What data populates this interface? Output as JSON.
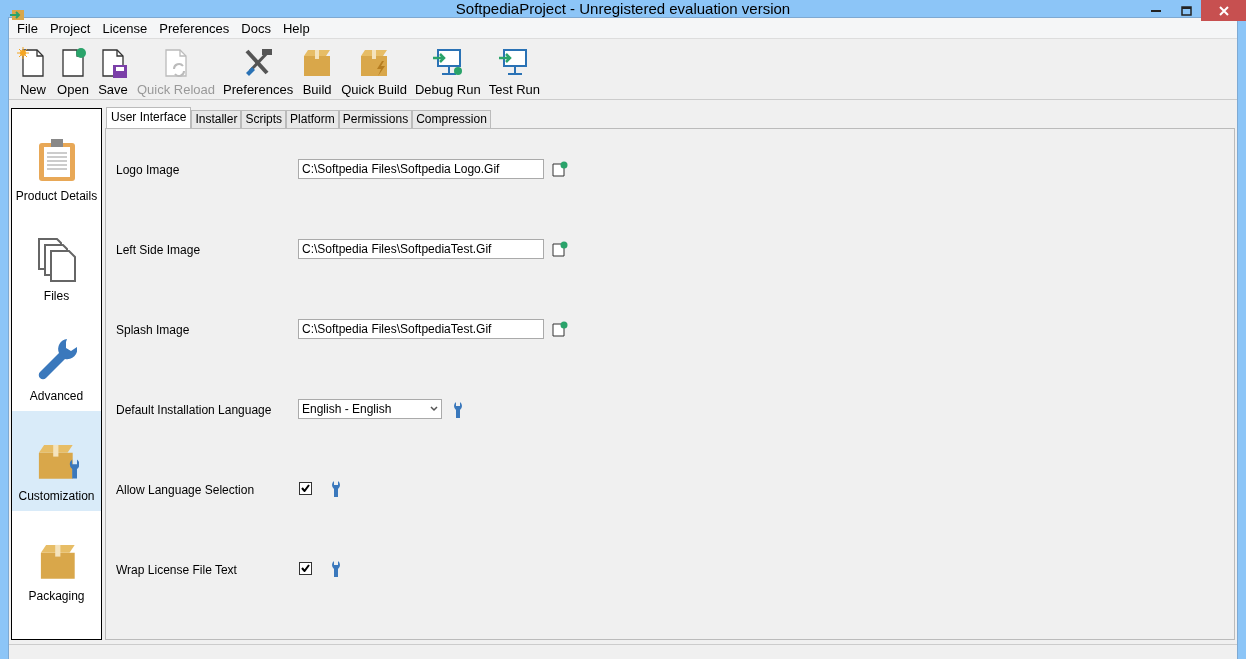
{
  "window": {
    "title": "SoftpediaProject - Unregistered evaluation version"
  },
  "menu": [
    "File",
    "Project",
    "License",
    "Preferences",
    "Docs",
    "Help"
  ],
  "toolbar": [
    {
      "label": "New",
      "kind": "new",
      "disabled": false
    },
    {
      "label": "Open",
      "kind": "open",
      "disabled": false
    },
    {
      "label": "Save",
      "kind": "save",
      "disabled": false
    },
    {
      "label": "Quick Reload",
      "kind": "reload",
      "disabled": true
    },
    {
      "label": "Preferences",
      "kind": "tools",
      "disabled": false
    },
    {
      "label": "Build",
      "kind": "box",
      "disabled": false
    },
    {
      "label": "Quick Build",
      "kind": "quickbox",
      "disabled": false
    },
    {
      "label": "Debug Run",
      "kind": "debug",
      "disabled": false
    },
    {
      "label": "Test Run",
      "kind": "run",
      "disabled": false
    }
  ],
  "sidebar": {
    "items": [
      {
        "label": "Product Details",
        "kind": "clipboard",
        "selected": false
      },
      {
        "label": "Files",
        "kind": "files",
        "selected": false
      },
      {
        "label": "Advanced",
        "kind": "wrench",
        "selected": false
      },
      {
        "label": "Customization",
        "kind": "boxwrench",
        "selected": true
      },
      {
        "label": "Packaging",
        "kind": "box",
        "selected": false
      }
    ]
  },
  "tabs": [
    {
      "label": "User Interface",
      "selected": true
    },
    {
      "label": "Installer",
      "selected": false
    },
    {
      "label": "Scripts",
      "selected": false
    },
    {
      "label": "Platform",
      "selected": false
    },
    {
      "label": "Permissions",
      "selected": false
    },
    {
      "label": "Compression",
      "selected": false
    }
  ],
  "settings": [
    {
      "label": "Logo Image",
      "kind": "file",
      "value": "C:\\Softpedia Files\\Softpedia Logo.Gif"
    },
    {
      "label": "Left Side Image",
      "kind": "file",
      "value": "C:\\Softpedia Files\\SoftpediaTest.Gif"
    },
    {
      "label": "Splash Image",
      "kind": "file",
      "value": "C:\\Softpedia Files\\SoftpediaTest.Gif"
    },
    {
      "label": "Default Installation Language",
      "kind": "select",
      "value": "English - English"
    },
    {
      "label": "Allow Language Selection",
      "kind": "checkbox",
      "checked": true
    },
    {
      "label": "Wrap License File Text",
      "kind": "checkbox",
      "checked": true
    }
  ]
}
